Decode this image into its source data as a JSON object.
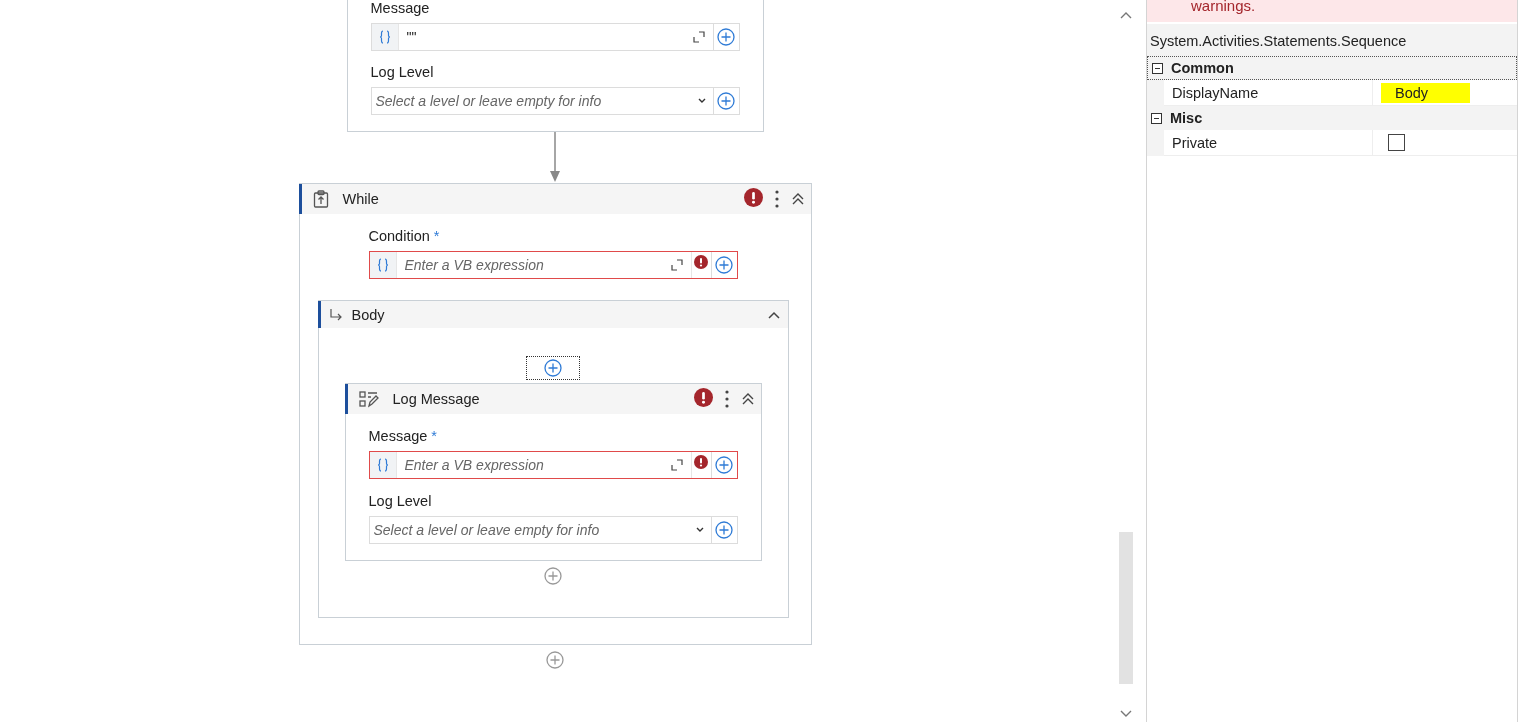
{
  "top_activity": {
    "fields": [
      {
        "kind": "expression",
        "label": "Message",
        "value": "\"\"",
        "error": false
      },
      {
        "kind": "dropdown",
        "label": "Log Level",
        "placeholder": "Select a level or leave empty for info"
      }
    ]
  },
  "while_activity": {
    "title": "While",
    "kind": "while",
    "error": true,
    "expanded": true,
    "fields": [
      {
        "kind": "expression",
        "label": "Condition",
        "required_mark": "*",
        "placeholder": "Enter a VB expression",
        "error": true
      }
    ],
    "body": {
      "title": "Body",
      "expanded": true,
      "activities": [
        {
          "title": "Log Message",
          "kind": "log",
          "error": true,
          "expanded": true,
          "fields": [
            {
              "kind": "expression",
              "label": "Message",
              "required_mark": "*",
              "placeholder": "Enter a VB expression",
              "error": true
            },
            {
              "kind": "dropdown",
              "label": "Log Level",
              "placeholder": "Select a level or leave empty for info"
            }
          ]
        }
      ]
    }
  },
  "properties": {
    "warning": "warnings.",
    "type_name": "System.Activities.Statements.Sequence",
    "categories": [
      {
        "name": "Common",
        "expanded": true,
        "properties": [
          {
            "kind": "text",
            "name": "DisplayName",
            "value": "Body",
            "highlighted": true
          }
        ]
      },
      {
        "name": "Misc",
        "expanded": true,
        "properties": [
          {
            "kind": "checkbox",
            "name": "Private",
            "checked": false
          }
        ]
      }
    ]
  }
}
